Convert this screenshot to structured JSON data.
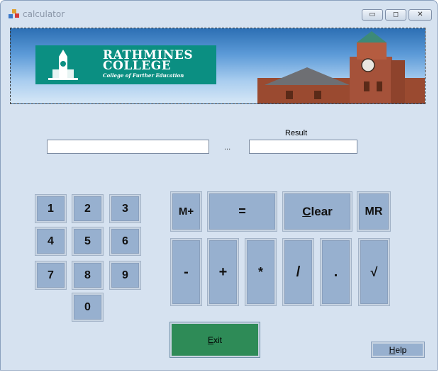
{
  "window": {
    "title": "calculator",
    "minimize_glyph": "▭",
    "maximize_glyph": "◻",
    "close_glyph": "✕"
  },
  "banner": {
    "logo_line1": "RATHMINES",
    "logo_line2": "COLLEGE",
    "logo_tagline": "College of Further Education"
  },
  "inputs": {
    "first_number": "",
    "second_number": "",
    "operator_placeholder": "...",
    "result_label": "Result"
  },
  "digits": {
    "d1": "1",
    "d2": "2",
    "d3": "3",
    "d4": "4",
    "d5": "5",
    "d6": "6",
    "d7": "7",
    "d8": "8",
    "d9": "9",
    "d0": "0"
  },
  "operators": {
    "mplus": "M+",
    "equals": "=",
    "clear_first": "C",
    "clear_rest": "lear",
    "mr": "MR",
    "minus": "-",
    "plus": "+",
    "multiply": "*",
    "divide": "/",
    "decimal": ".",
    "sqrt": "√"
  },
  "actions": {
    "exit_first": "E",
    "exit_rest": "xit",
    "help_first": "H",
    "help_rest": "elp"
  },
  "colors": {
    "window_bg": "#d6e2f0",
    "button_bg": "#97b0cf",
    "exit_bg": "#2e8b57",
    "logo_bg": "#0b8f82"
  }
}
